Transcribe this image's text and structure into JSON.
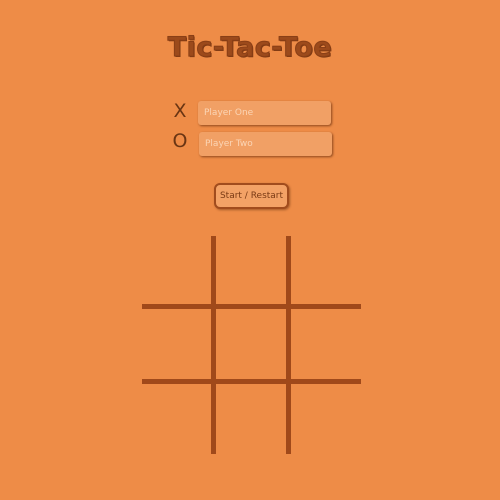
{
  "title": "Tic-Tac-Toe",
  "players": [
    {
      "symbol": "X",
      "value": "",
      "placeholder": "Player One"
    },
    {
      "symbol": "O",
      "value": "",
      "placeholder": "Player Two"
    }
  ],
  "controls": {
    "start_restart_label": "Start / Restart"
  },
  "board": {
    "cells": [
      "",
      "",
      "",
      "",
      "",
      "",
      "",
      "",
      ""
    ]
  },
  "colors": {
    "background": "#ee8c47",
    "grid_lines": "#a0491a",
    "title": "#9c4a1b",
    "input_background": "#f1a065"
  }
}
